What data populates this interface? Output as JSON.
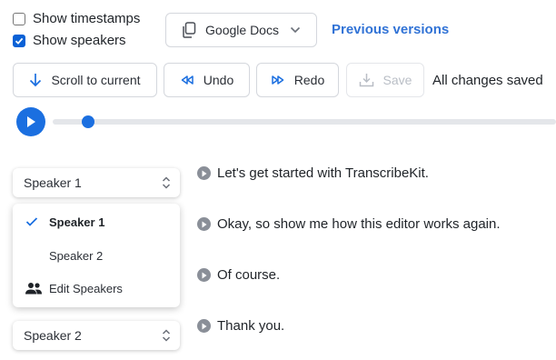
{
  "options": {
    "show_timestamps": {
      "label": "Show timestamps",
      "checked": false
    },
    "show_speakers": {
      "label": "Show speakers",
      "checked": true
    }
  },
  "export": {
    "label": "Google Docs",
    "icon": "copy-icon"
  },
  "previous_versions": "Previous versions",
  "toolbar": {
    "scroll_label": "Scroll to current",
    "undo_label": "Undo",
    "redo_label": "Redo",
    "save_label": "Save",
    "status": "All changes saved"
  },
  "player": {
    "progress": 0.07,
    "accent": "#1b6fe0"
  },
  "speaker_menu": {
    "items": [
      "Speaker 1",
      "Speaker 2"
    ],
    "selected": "Speaker 1",
    "edit_label": "Edit Speakers"
  },
  "segments": [
    {
      "speaker": "Speaker 1",
      "text": "Let's get started with TranscribeKit."
    },
    {
      "text": "Okay, so show me how this editor works again."
    },
    {
      "text": "Of course."
    },
    {
      "speaker": "Speaker 2",
      "text": "Thank you."
    }
  ],
  "colors": {
    "link": "#3173d6",
    "play": "#1b6fe0",
    "checkbox": "#0a61d6"
  }
}
